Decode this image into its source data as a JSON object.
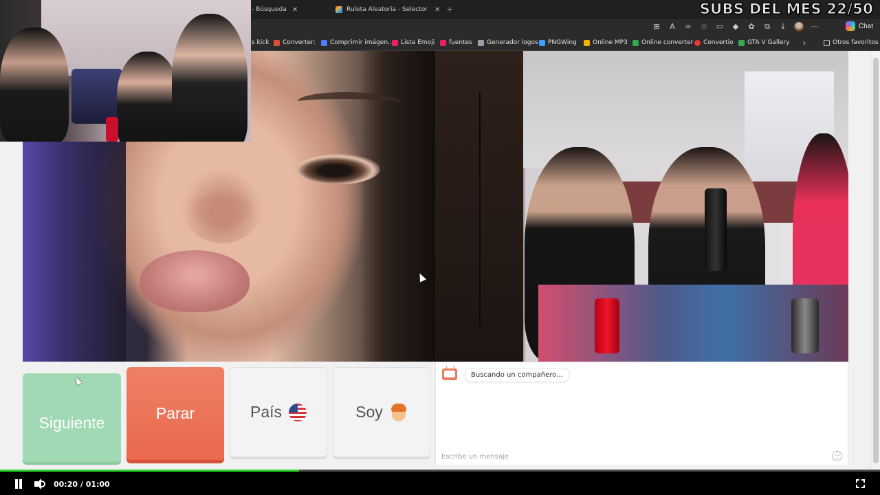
{
  "browser": {
    "tabs": [
      {
        "label": "- Búsqueda"
      },
      {
        "label": "Ruleta Aleatoria - Selector Person"
      }
    ],
    "overlay_banner": "SUBS DEL MES 22/50",
    "chat_button": "Chat",
    "bookmarks": [
      {
        "label": "s kick",
        "color": "#2b2b2b"
      },
      {
        "label": "Converter:",
        "color": "#e44b37"
      },
      {
        "label": "Comprimir imágen...",
        "color": "#4f7cff"
      },
      {
        "label": "Lista Emoji",
        "color": "#e91e63"
      },
      {
        "label": "fuentes",
        "color": "#e91e63"
      },
      {
        "label": "Generador logos",
        "color": "#9aa0a6"
      },
      {
        "label": "PNGWing",
        "color": "#3aa0ff"
      },
      {
        "label": "Online MP3",
        "color": "#f4b400"
      },
      {
        "label": "Online converter",
        "color": "#34a853"
      },
      {
        "label": "Convertio",
        "color": "#e53935"
      },
      {
        "label": "GTA V Gallery",
        "color": "#34a853"
      },
      {
        "label": "Otros favoritos",
        "color": "#cfcfcf"
      }
    ]
  },
  "controls_panel": {
    "next_label": "Siguiente",
    "stop_label": "Parar",
    "country_label": "País",
    "country_flag": "us-flag-icon",
    "iam_label": "Soy",
    "iam_icon": "boy-emoji-icon"
  },
  "chat": {
    "status_message": "Buscando un compañero...",
    "input_placeholder": "Escribe un mensaje"
  },
  "player": {
    "time_display": "00:20 / 01:00",
    "progress": 0.34,
    "progress_color": "#2cd52c"
  }
}
